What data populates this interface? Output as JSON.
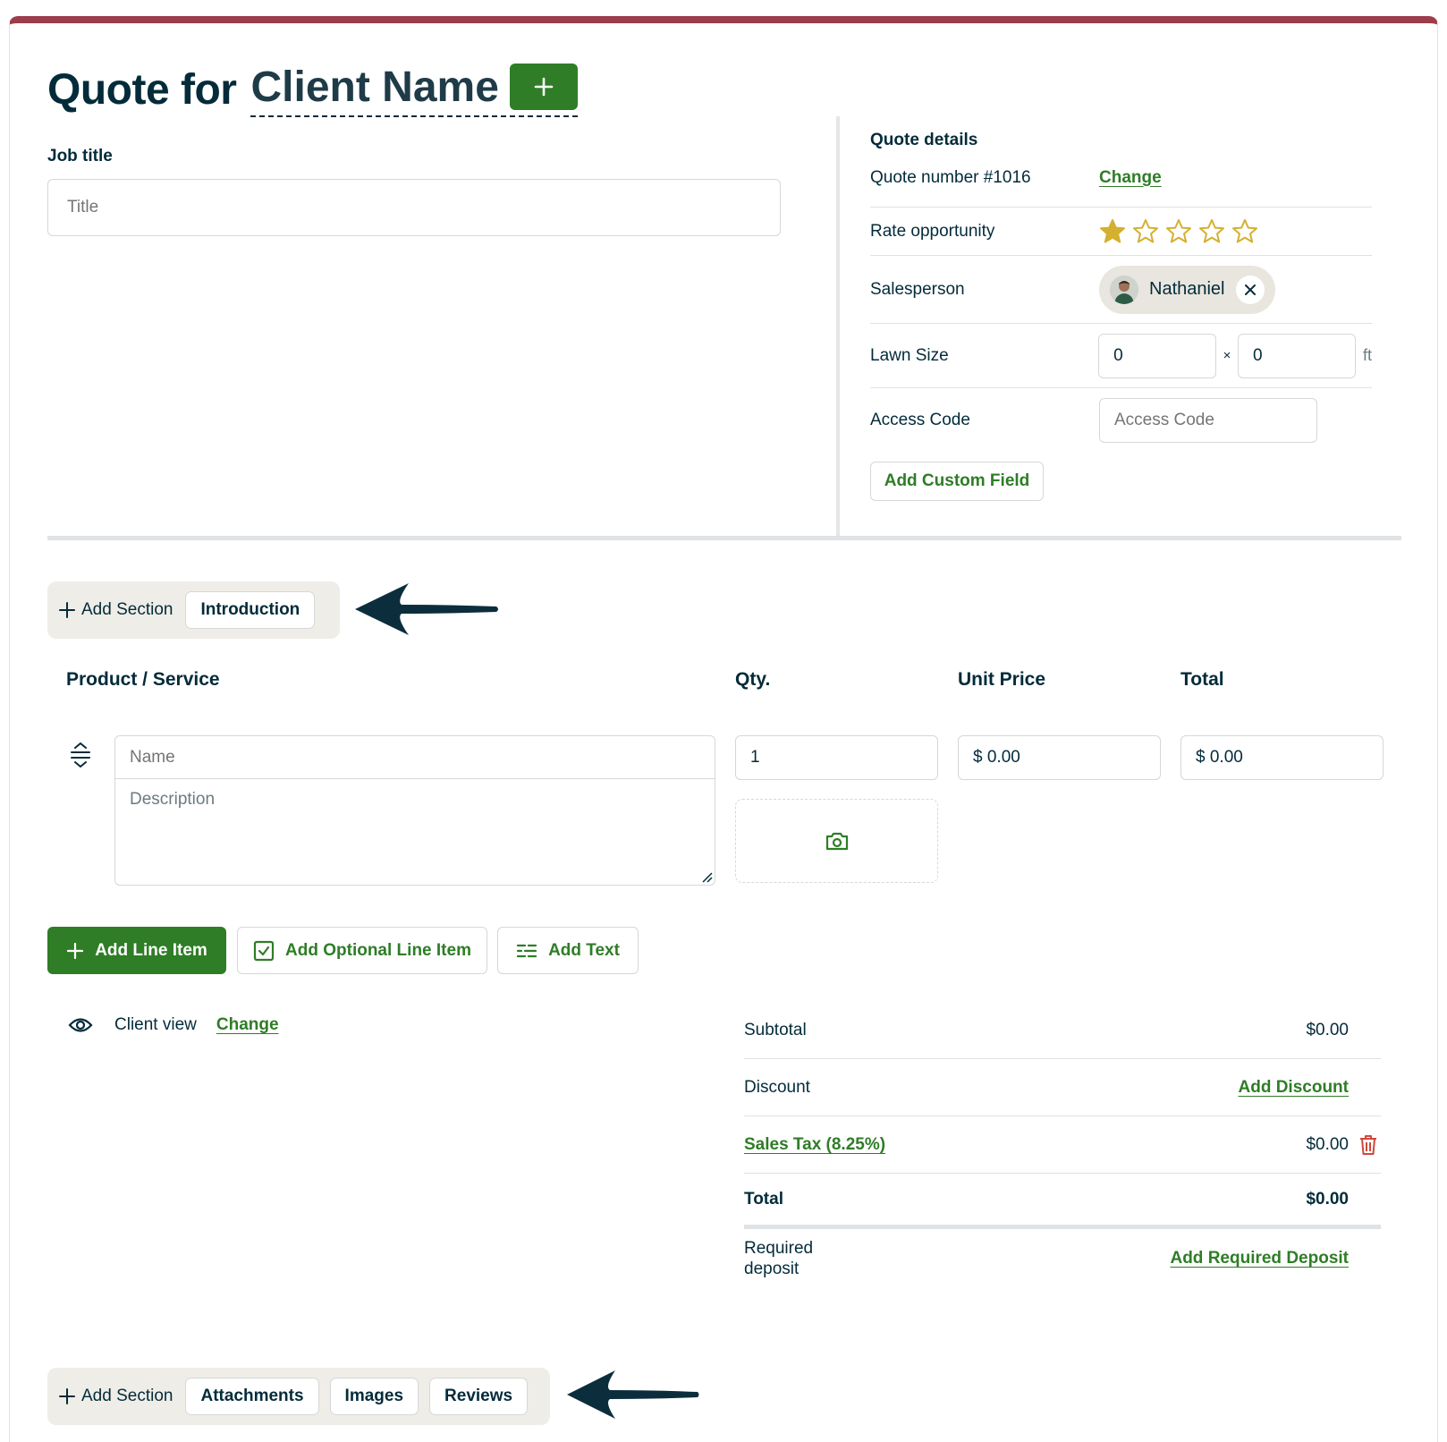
{
  "header": {
    "title_prefix": "Quote for",
    "client_name": "Client Name",
    "add_client_symbol": "+"
  },
  "job": {
    "label": "Job title",
    "placeholder": "Title"
  },
  "quote_details": {
    "heading": "Quote details",
    "quote_number_label": "Quote number #1016",
    "quote_number_action": "Change",
    "rate_label": "Rate opportunity",
    "rating": 1,
    "rating_max": 5,
    "salesperson_label": "Salesperson",
    "salesperson_name": "Nathaniel",
    "lawn_size_label": "Lawn Size",
    "lawn_width": "0",
    "lawn_length": "0",
    "lawn_times": "×",
    "lawn_unit": "ft",
    "access_code_label": "Access Code",
    "access_code_placeholder": "Access Code",
    "add_custom_field": "Add Custom Field"
  },
  "top_sections": {
    "add_section": "Add Section",
    "items": [
      "Introduction"
    ]
  },
  "line_items": {
    "headers": {
      "product": "Product / Service",
      "qty": "Qty.",
      "unit_price": "Unit Price",
      "total": "Total"
    },
    "row": {
      "name_placeholder": "Name",
      "description_placeholder": "Description",
      "qty": "1",
      "unit_price": "$ 0.00",
      "total": "$ 0.00"
    }
  },
  "actions": {
    "add_line_item": "Add Line Item",
    "add_optional_line_item": "Add Optional Line Item",
    "add_text": "Add Text"
  },
  "client_view": {
    "label": "Client view",
    "action": "Change"
  },
  "summary": {
    "subtotal_label": "Subtotal",
    "subtotal_value": "$0.00",
    "discount_label": "Discount",
    "discount_action": "Add Discount",
    "tax_label": "Sales Tax (8.25%)",
    "tax_value": "$0.00",
    "total_label": "Total",
    "total_value": "$0.00",
    "deposit_label_line1": "Required",
    "deposit_label_line2": "deposit",
    "deposit_action": "Add Required Deposit"
  },
  "bottom_sections": {
    "add_section": "Add Section",
    "items": [
      "Attachments",
      "Images",
      "Reviews"
    ]
  },
  "colors": {
    "brand_green": "#2f7d27",
    "top_accent": "#9b3d4b",
    "star_gold": "#d4b02f",
    "danger_red": "#d0473c",
    "arrow_navy": "#0c2e3c"
  }
}
